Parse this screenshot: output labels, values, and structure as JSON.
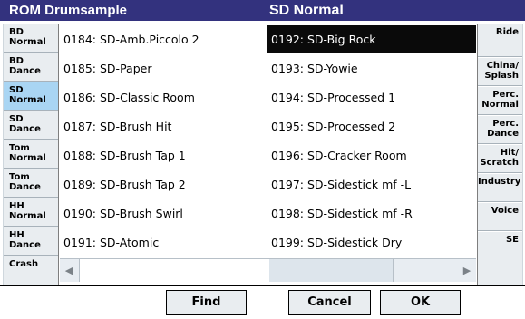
{
  "title": {
    "left": "ROM Drumsample",
    "right": "SD Normal"
  },
  "left_tabs": [
    {
      "line1": "BD",
      "line2": "Normal"
    },
    {
      "line1": "BD",
      "line2": "Dance"
    },
    {
      "line1": "SD",
      "line2": "Normal"
    },
    {
      "line1": "SD",
      "line2": "Dance"
    },
    {
      "line1": "Tom",
      "line2": "Normal"
    },
    {
      "line1": "Tom",
      "line2": "Dance"
    },
    {
      "line1": "HH",
      "line2": "Normal"
    },
    {
      "line1": "HH",
      "line2": "Dance"
    },
    {
      "line1": "Crash",
      "line2": ""
    }
  ],
  "left_selected_index": 2,
  "right_tabs": [
    {
      "line1": "Ride",
      "line2": ""
    },
    {
      "line1": "China/",
      "line2": "Splash"
    },
    {
      "line1": "Perc.",
      "line2": "Normal"
    },
    {
      "line1": "Perc.",
      "line2": "Dance"
    },
    {
      "line1": "Hit/",
      "line2": "Scratch"
    },
    {
      "line1": "Industry",
      "line2": ""
    },
    {
      "line1": "Voice",
      "line2": ""
    },
    {
      "line1": "SE",
      "line2": ""
    }
  ],
  "list": {
    "col0": [
      "0184: SD-Amb.Piccolo 2",
      "0185: SD-Paper",
      "0186: SD-Classic Room",
      "0187: SD-Brush Hit",
      "0188: SD-Brush Tap 1",
      "0189: SD-Brush Tap 2",
      "0190: SD-Brush Swirl",
      "0191: SD-Atomic"
    ],
    "col1": [
      "0192: SD-Big Rock",
      "0193: SD-Yowie",
      "0194: SD-Processed 1",
      "0195: SD-Processed 2",
      "0196: SD-Cracker Room",
      "0197: SD-Sidestick mf -L",
      "0198: SD-Sidestick mf -R",
      "0199: SD-Sidestick Dry"
    ],
    "selected": "0192: SD-Big Rock"
  },
  "scrollbar": {
    "left_arrow": "◀",
    "right_arrow": "▶"
  },
  "buttons": {
    "find": "Find",
    "cancel": "Cancel",
    "ok": "OK"
  }
}
